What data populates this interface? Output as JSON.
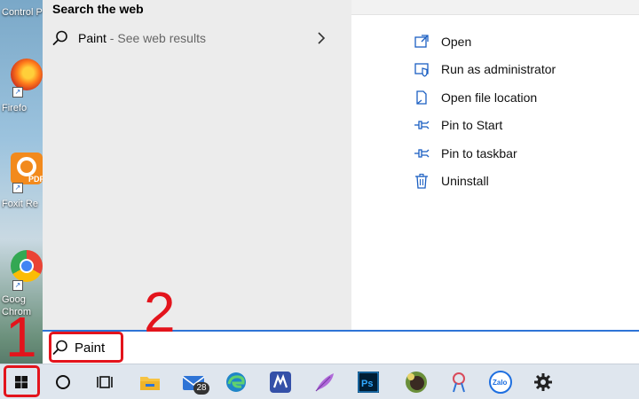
{
  "desktop": {
    "icons": [
      {
        "label": "Control P",
        "icon": "control-panel-icon"
      },
      {
        "label": "Firefo",
        "icon": "firefox-icon"
      },
      {
        "label": "Foxit Re",
        "icon": "foxit-pdf-icon"
      },
      {
        "label": "Goog",
        "icon": "chrome-icon"
      },
      {
        "label": "Chrom",
        "icon": "chrome-icon"
      }
    ]
  },
  "start_menu": {
    "section_title": "Search the web",
    "web_result": {
      "query": "Paint",
      "suffix": " - See web results",
      "icon": "search-icon"
    },
    "actions": [
      {
        "label": "Open",
        "icon": "open-icon"
      },
      {
        "label": "Run as administrator",
        "icon": "admin-shield-icon"
      },
      {
        "label": "Open file location",
        "icon": "file-location-icon"
      },
      {
        "label": "Pin to Start",
        "icon": "pin-icon"
      },
      {
        "label": "Pin to taskbar",
        "icon": "pin-icon"
      },
      {
        "label": "Uninstall",
        "icon": "trash-icon"
      }
    ]
  },
  "search": {
    "value": "Paint"
  },
  "annotations": {
    "step1": "1",
    "step2": "2"
  },
  "taskbar": {
    "items": [
      {
        "name": "start-button",
        "icon": "windows-logo-icon"
      },
      {
        "name": "cortana-button",
        "icon": "circle-icon"
      },
      {
        "name": "task-view-button",
        "icon": "task-view-icon"
      },
      {
        "name": "file-explorer",
        "icon": "folder-icon"
      },
      {
        "name": "mail",
        "icon": "mail-icon",
        "badge": "28"
      },
      {
        "name": "edge",
        "icon": "edge-icon"
      },
      {
        "name": "app-m",
        "icon": "m-app-icon"
      },
      {
        "name": "feather-app",
        "icon": "feather-icon"
      },
      {
        "name": "photoshop",
        "icon": "photoshop-icon",
        "text": "Ps"
      },
      {
        "name": "avatar-app",
        "icon": "avatar-icon"
      },
      {
        "name": "snipping-app",
        "icon": "snip-icon"
      },
      {
        "name": "zalo",
        "icon": "zalo-icon",
        "text": "Zalo"
      },
      {
        "name": "settings",
        "icon": "gear-icon"
      }
    ]
  },
  "colors": {
    "accent": "#2e74d6",
    "annotation": "#e3141c",
    "icon_blue": "#1b5fc2"
  }
}
